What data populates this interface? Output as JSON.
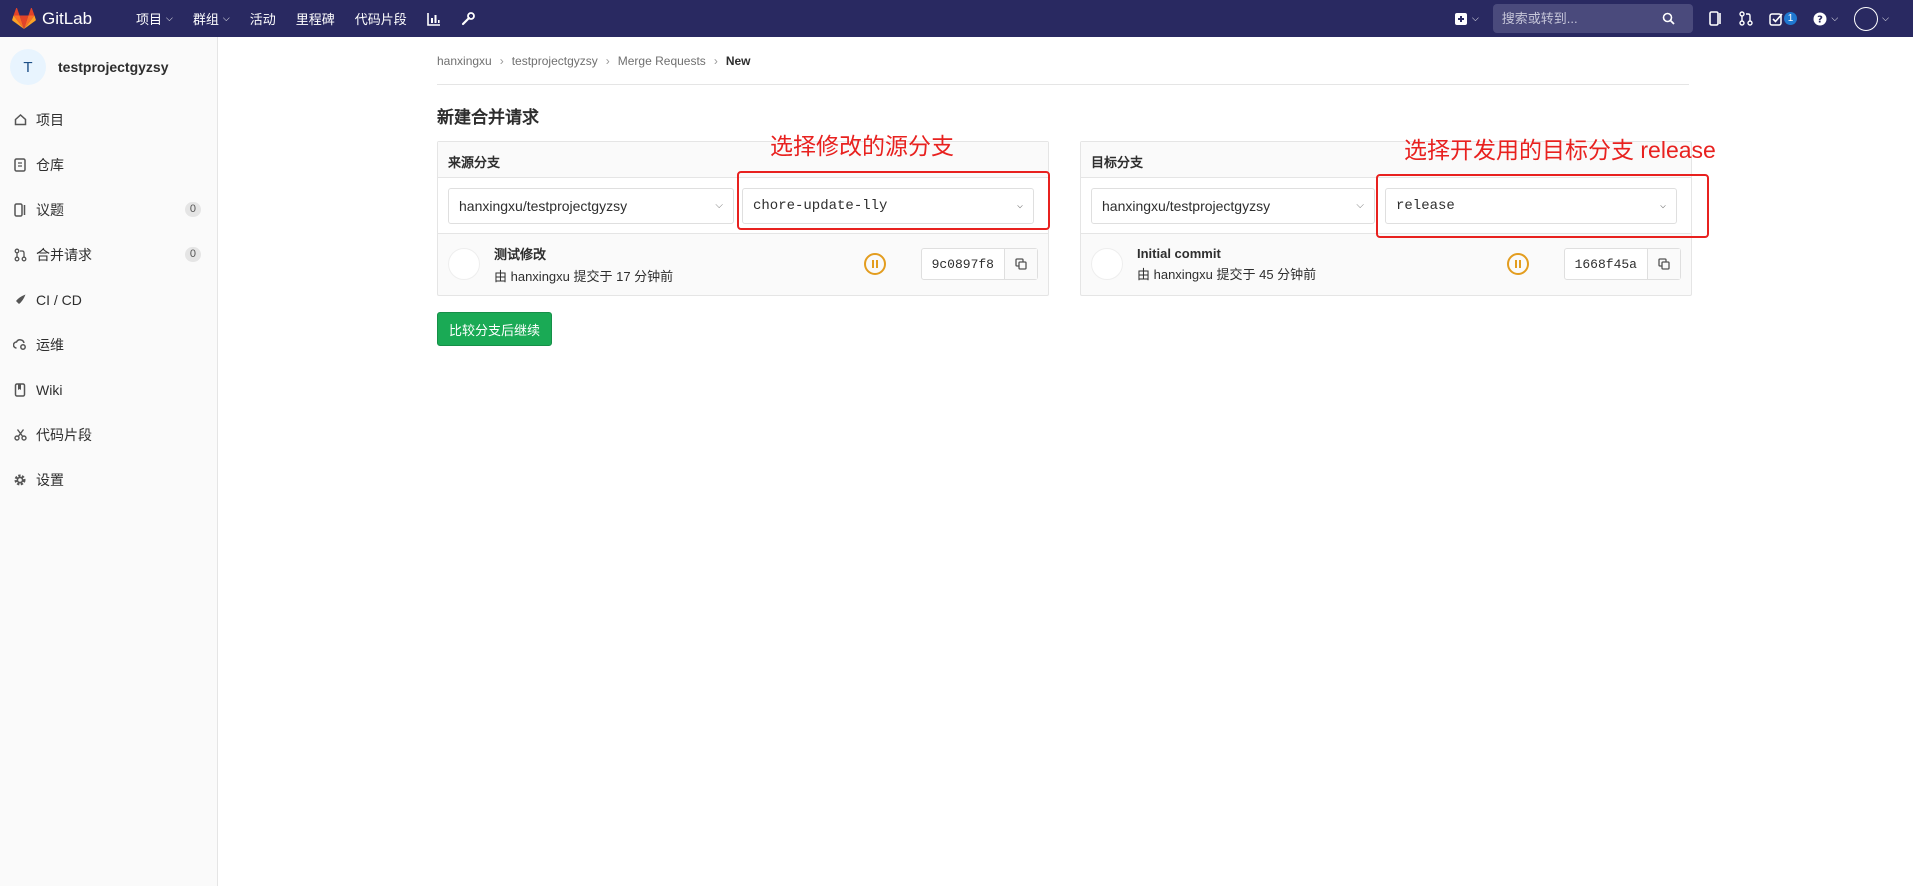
{
  "navbar": {
    "brand": "GitLab",
    "links": [
      {
        "label": "项目",
        "caret": true
      },
      {
        "label": "群组",
        "caret": true
      },
      {
        "label": "活动",
        "caret": false
      },
      {
        "label": "里程碑",
        "caret": false
      },
      {
        "label": "代码片段",
        "caret": false
      }
    ],
    "search_placeholder": "搜索或转到...",
    "todo_count": "1",
    "brand_color": "#292961"
  },
  "sidebar": {
    "avatar_letter": "T",
    "project_name": "testprojectgyzsy",
    "items": [
      {
        "label": "项目",
        "icon": "home-icon"
      },
      {
        "label": "仓库",
        "icon": "doc-icon"
      },
      {
        "label": "议题",
        "icon": "issues-icon",
        "badge": "0"
      },
      {
        "label": "合并请求",
        "icon": "merge-request-icon",
        "badge": "0"
      },
      {
        "label": "CI / CD",
        "icon": "rocket-icon"
      },
      {
        "label": "运维",
        "icon": "cloud-gear-icon"
      },
      {
        "label": "Wiki",
        "icon": "book-icon"
      },
      {
        "label": "代码片段",
        "icon": "scissors-icon"
      },
      {
        "label": "设置",
        "icon": "gear-icon"
      }
    ]
  },
  "breadcrumb": {
    "items": [
      "hanxingxu",
      "testprojectgyzsy",
      "Merge Requests"
    ],
    "current": "New"
  },
  "page": {
    "title": "新建合并请求",
    "compare_button": "比较分支后继续"
  },
  "source": {
    "header": "来源分支",
    "project": "hanxingxu/testprojectgyzsy",
    "branch": "chore-update-lly",
    "commit_title": "测试修改",
    "commit_meta": "由 hanxingxu 提交于 17 分钟前",
    "sha": "9c0897f8"
  },
  "target": {
    "header": "目标分支",
    "project": "hanxingxu/testprojectgyzsy",
    "branch": "release",
    "commit_title": "Initial commit",
    "commit_meta": "由 hanxingxu 提交于 45 分钟前",
    "sha": "1668f45a"
  },
  "annotations": {
    "source_note": "选择修改的源分支",
    "target_note": "选择开发用的目标分支 release",
    "color": "#e8211f"
  }
}
